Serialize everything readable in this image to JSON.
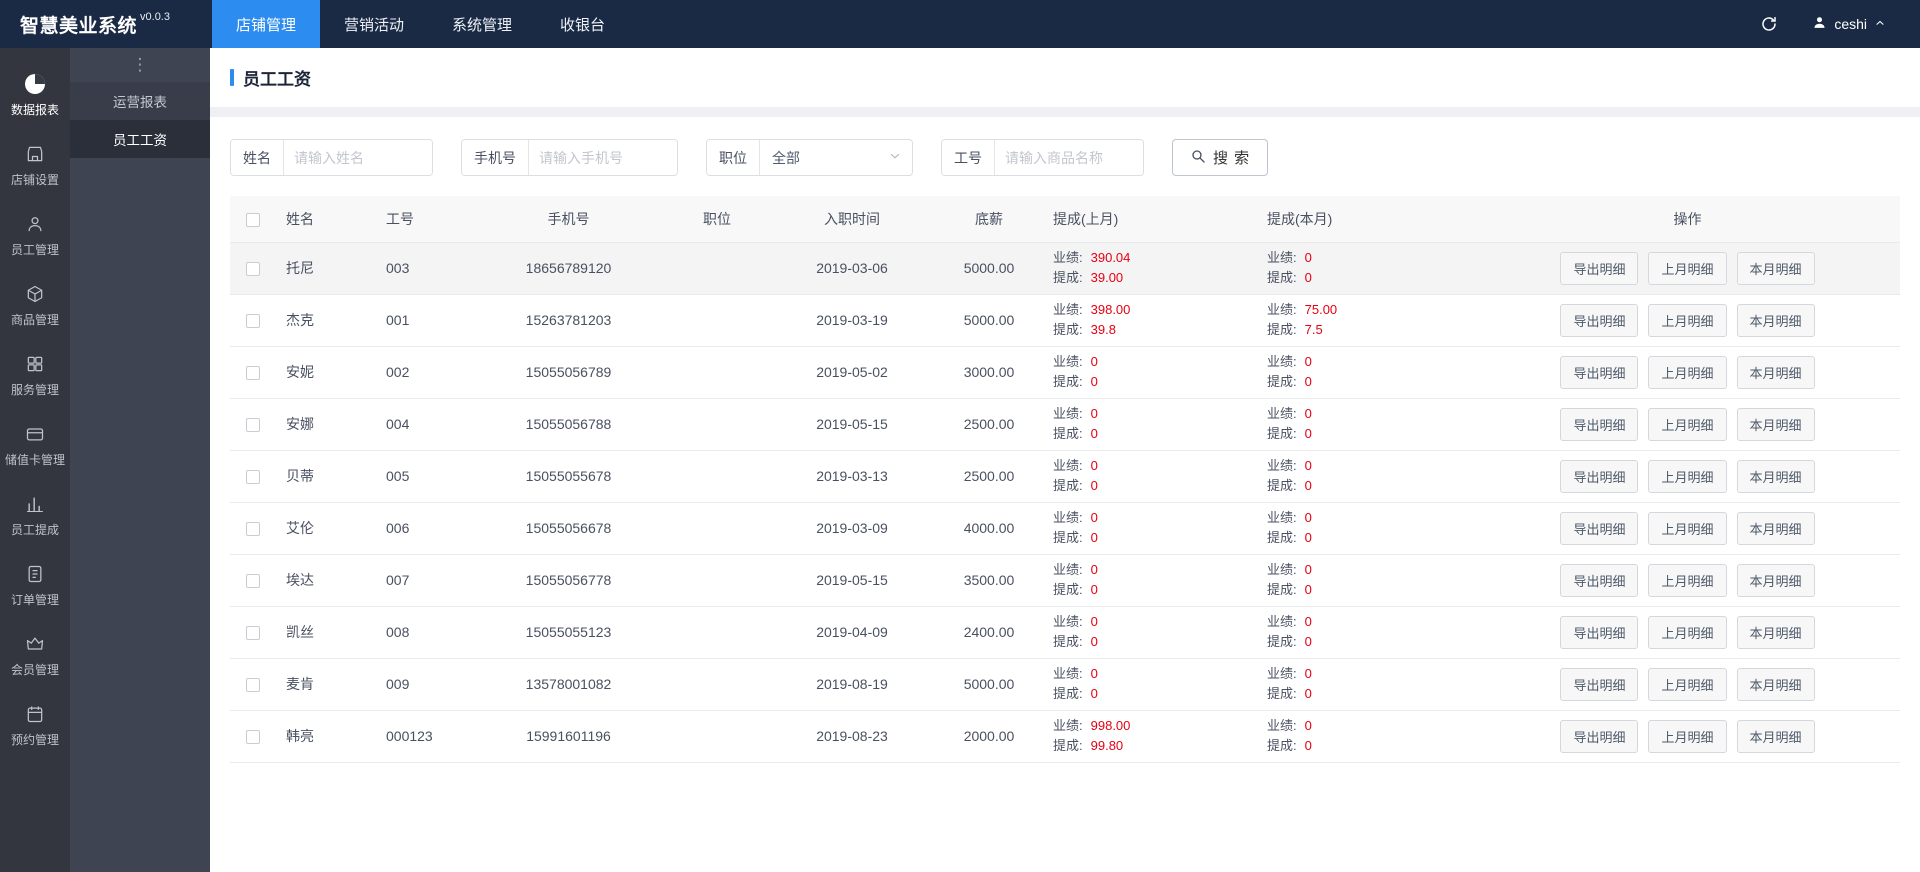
{
  "colors": {
    "accent": "#2d8cf0",
    "value-red": "#e60012"
  },
  "topbar": {
    "title": "智慧美业系统",
    "version": "v0.0.3",
    "tabs": [
      {
        "id": "shop-management",
        "label": "店铺管理",
        "active": true
      },
      {
        "id": "marketing-activities",
        "label": "营销活动",
        "active": false
      },
      {
        "id": "system-management",
        "label": "系统管理",
        "active": false
      },
      {
        "id": "cashier",
        "label": "收银台",
        "active": false
      }
    ],
    "user": "ceshi"
  },
  "sidebar": {
    "items": [
      {
        "id": "data-reports",
        "label": "数据报表",
        "icon": "pie-chart-icon",
        "active": true
      },
      {
        "id": "shop-settings",
        "label": "店铺设置",
        "icon": "store-icon",
        "active": false
      },
      {
        "id": "staff-management",
        "label": "员工管理",
        "icon": "user-icon",
        "active": false
      },
      {
        "id": "goods-management",
        "label": "商品管理",
        "icon": "box-icon",
        "active": false
      },
      {
        "id": "service-management",
        "label": "服务管理",
        "icon": "grid-icon",
        "active": false
      },
      {
        "id": "stored-card-management",
        "label": "储值卡管理",
        "icon": "card-icon",
        "active": false
      },
      {
        "id": "staff-commission",
        "label": "员工提成",
        "icon": "bar-chart-icon",
        "active": false
      },
      {
        "id": "order-management",
        "label": "订单管理",
        "icon": "document-icon",
        "active": false
      },
      {
        "id": "member-management",
        "label": "会员管理",
        "icon": "crown-icon",
        "active": false
      },
      {
        "id": "appointment-management",
        "label": "预约管理",
        "icon": "calendar-icon",
        "active": false
      }
    ]
  },
  "submenu": {
    "items": [
      {
        "id": "operation-reports",
        "label": "运营报表",
        "active": false
      },
      {
        "id": "staff-wages",
        "label": "员工工资",
        "active": true
      }
    ]
  },
  "page": {
    "title": "员工工资"
  },
  "filters": {
    "name": {
      "label": "姓名",
      "placeholder": "请输入姓名"
    },
    "phone": {
      "label": "手机号",
      "placeholder": "请输入手机号"
    },
    "position": {
      "label": "职位",
      "value": "全部"
    },
    "job_no": {
      "label": "工号",
      "placeholder": "请输入商品名称"
    },
    "search_label": "搜 索"
  },
  "table": {
    "headers": [
      "姓名",
      "工号",
      "手机号",
      "职位",
      "入职时间",
      "底薪",
      "提成(上月)",
      "提成(本月)",
      "操作"
    ],
    "perf_label": "业绩:",
    "comm_label": "提成:",
    "actions": [
      "导出明细",
      "上月明细",
      "本月明细"
    ],
    "rows": [
      {
        "name": "托尼",
        "job_no": "003",
        "phone": "18656789120",
        "position": "",
        "hire_date": "2019-03-06",
        "base_salary": "5000.00",
        "last_month": {
          "perf": "390.04",
          "comm": "39.00"
        },
        "this_month": {
          "perf": "0",
          "comm": "0"
        }
      },
      {
        "name": "杰克",
        "job_no": "001",
        "phone": "15263781203",
        "position": "",
        "hire_date": "2019-03-19",
        "base_salary": "5000.00",
        "last_month": {
          "perf": "398.00",
          "comm": "39.8"
        },
        "this_month": {
          "perf": "75.00",
          "comm": "7.5"
        }
      },
      {
        "name": "安妮",
        "job_no": "002",
        "phone": "15055056789",
        "position": "",
        "hire_date": "2019-05-02",
        "base_salary": "3000.00",
        "last_month": {
          "perf": "0",
          "comm": "0"
        },
        "this_month": {
          "perf": "0",
          "comm": "0"
        }
      },
      {
        "name": "安娜",
        "job_no": "004",
        "phone": "15055056788",
        "position": "",
        "hire_date": "2019-05-15",
        "base_salary": "2500.00",
        "last_month": {
          "perf": "0",
          "comm": "0"
        },
        "this_month": {
          "perf": "0",
          "comm": "0"
        }
      },
      {
        "name": "贝蒂",
        "job_no": "005",
        "phone": "15055055678",
        "position": "",
        "hire_date": "2019-03-13",
        "base_salary": "2500.00",
        "last_month": {
          "perf": "0",
          "comm": "0"
        },
        "this_month": {
          "perf": "0",
          "comm": "0"
        }
      },
      {
        "name": "艾伦",
        "job_no": "006",
        "phone": "15055056678",
        "position": "",
        "hire_date": "2019-03-09",
        "base_salary": "4000.00",
        "last_month": {
          "perf": "0",
          "comm": "0"
        },
        "this_month": {
          "perf": "0",
          "comm": "0"
        }
      },
      {
        "name": "埃达",
        "job_no": "007",
        "phone": "15055056778",
        "position": "",
        "hire_date": "2019-05-15",
        "base_salary": "3500.00",
        "last_month": {
          "perf": "0",
          "comm": "0"
        },
        "this_month": {
          "perf": "0",
          "comm": "0"
        }
      },
      {
        "name": "凯丝",
        "job_no": "008",
        "phone": "15055055123",
        "position": "",
        "hire_date": "2019-04-09",
        "base_salary": "2400.00",
        "last_month": {
          "perf": "0",
          "comm": "0"
        },
        "this_month": {
          "perf": "0",
          "comm": "0"
        }
      },
      {
        "name": "麦肯",
        "job_no": "009",
        "phone": "13578001082",
        "position": "",
        "hire_date": "2019-08-19",
        "base_salary": "5000.00",
        "last_month": {
          "perf": "0",
          "comm": "0"
        },
        "this_month": {
          "perf": "0",
          "comm": "0"
        }
      },
      {
        "name": "韩亮",
        "job_no": "000123",
        "phone": "15991601196",
        "position": "",
        "hire_date": "2019-08-23",
        "base_salary": "2000.00",
        "last_month": {
          "perf": "998.00",
          "comm": "99.80"
        },
        "this_month": {
          "perf": "0",
          "comm": "0"
        }
      }
    ]
  }
}
